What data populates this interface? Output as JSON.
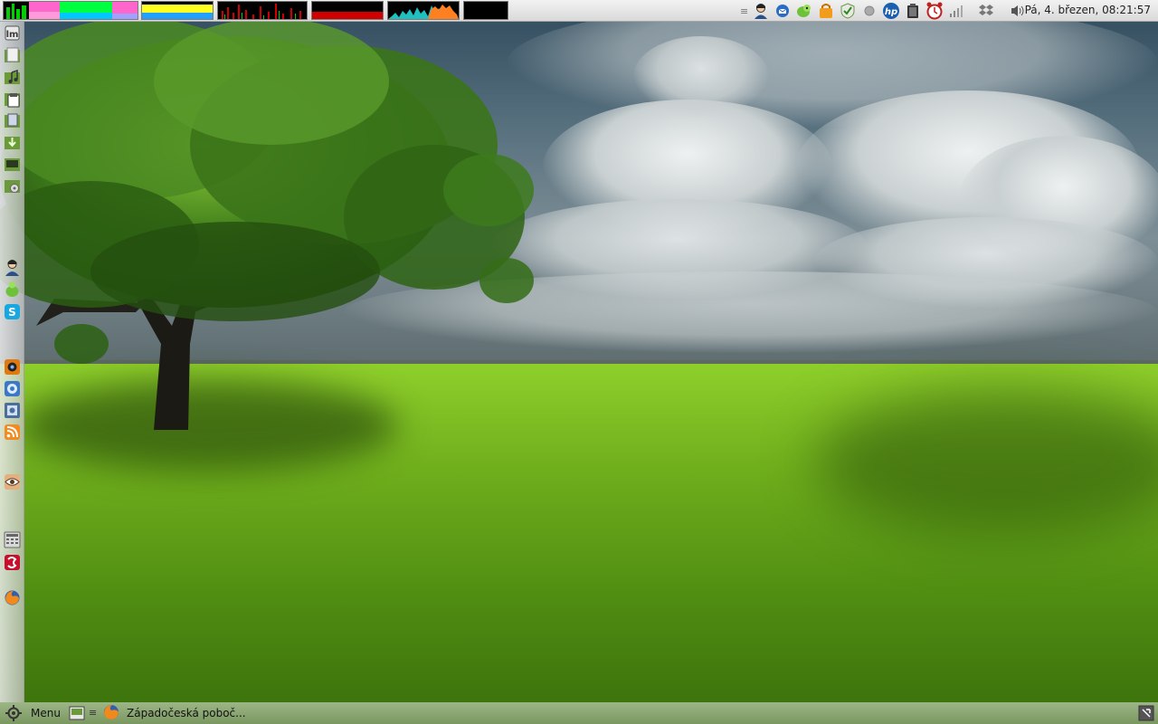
{
  "top_panel": {
    "clock": "Pá, 4. březen, 08:21:57",
    "tray_separator": "≡",
    "system_monitors": [
      "cpu-monitor",
      "memory-monitor",
      "network-monitor",
      "swap-monitor",
      "load-monitor",
      "disk-monitor"
    ],
    "tray_icons": [
      "user-icon",
      "thunderbird-icon",
      "pidgin-icon",
      "update-notifier-icon",
      "shield-icon",
      "record-icon",
      "hp-printer-icon",
      "clipboard-icon",
      "alarm-clock-icon",
      "signal-strength-icon",
      "dropbox-icon",
      "volume-icon"
    ]
  },
  "left_panel": {
    "launchers": [
      "mint-icon",
      "files-icon",
      "music-icon",
      "clipboard-paste-icon",
      "documents-icon",
      "download-icon",
      "terminal-icon",
      "settings-icon",
      "user-messenger-icon",
      "pidgin-green-icon",
      "skype-icon",
      "webcam-icon",
      "mail-icon",
      "screenshot-icon",
      "rss-icon",
      "eye-viewer-icon",
      "calculator-icon",
      "lastfm-icon",
      "firefox-icon"
    ]
  },
  "bottom_panel": {
    "menu_label": "Menu",
    "desktop_separator": "≡",
    "task_label": "Západočeská poboč..."
  },
  "colors": {
    "panel": "#e6e6e6",
    "grass": "#6fae1c",
    "sky": "#4a6577",
    "cpu": "#00d000",
    "mem_pink": "#ff66cc",
    "mem_green": "#00ff40",
    "mem_yellow": "#ffff20",
    "net_red": "#d00000",
    "disk_cyan": "#20c0c0",
    "disk_orange": "#ff8020"
  }
}
